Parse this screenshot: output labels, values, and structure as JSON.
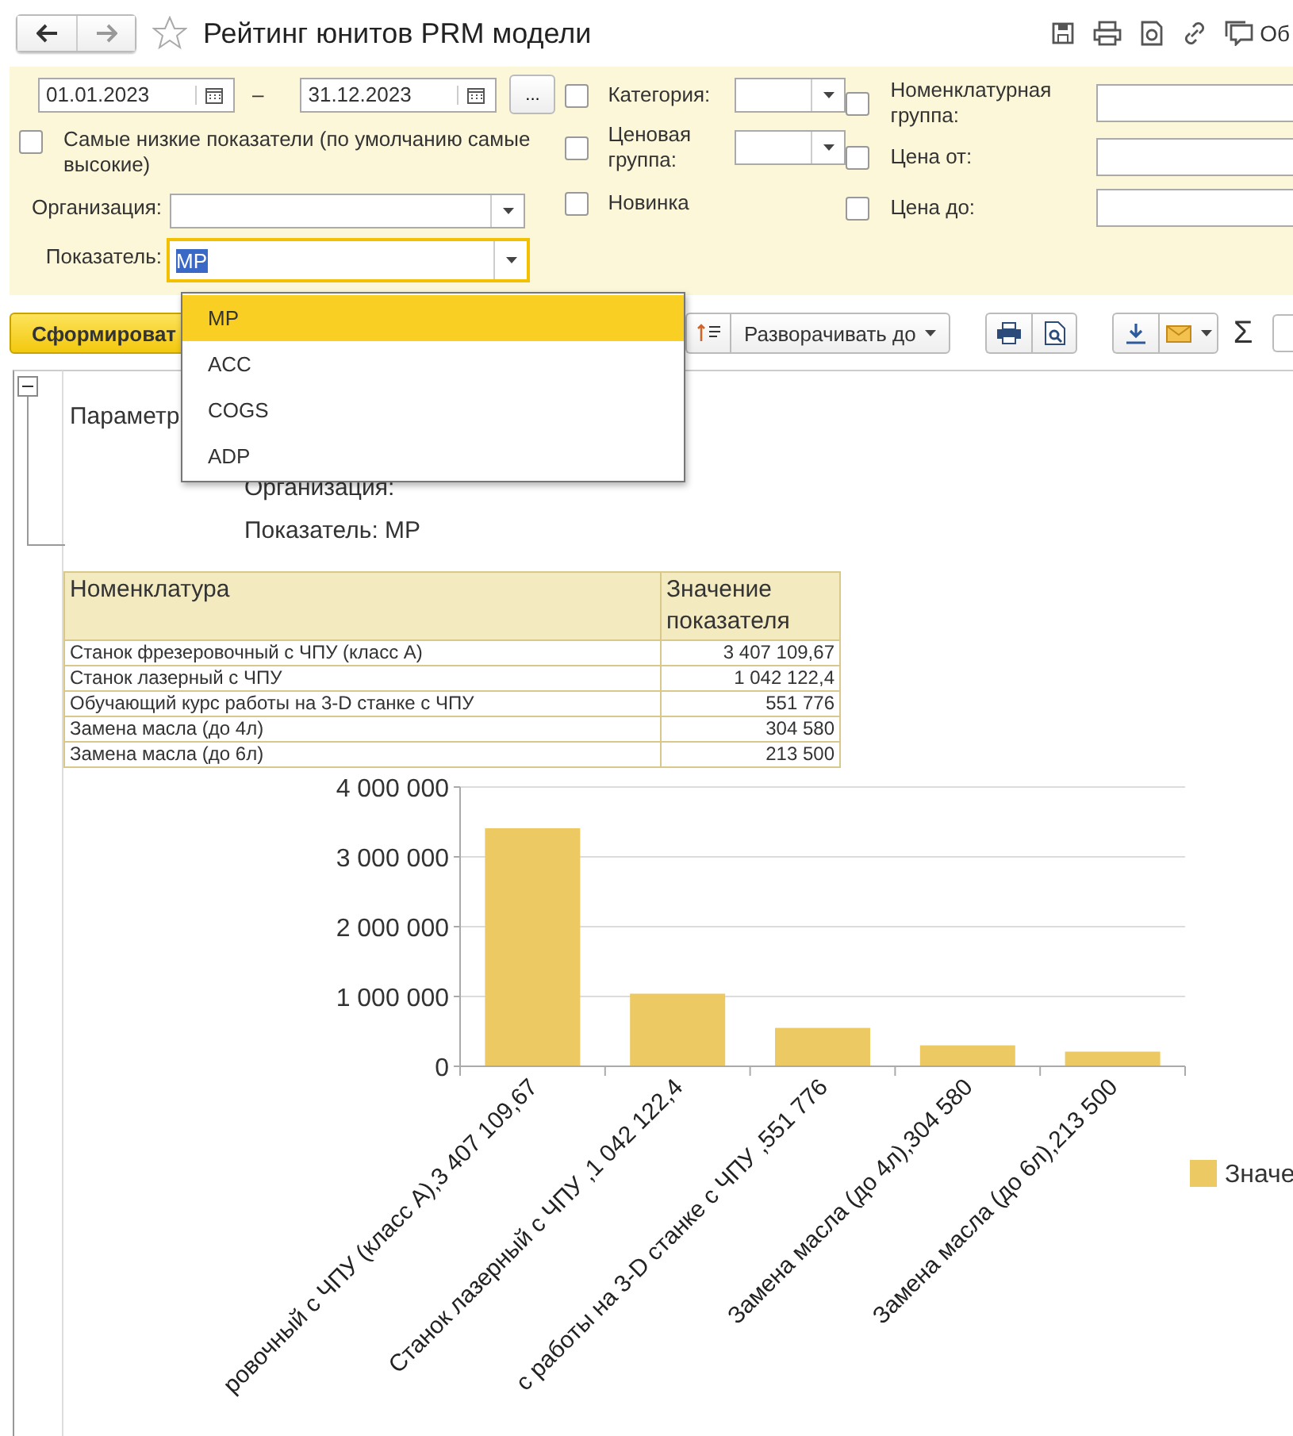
{
  "window": {
    "title": "Рейтинг юнитов PRM модели",
    "favorite": false,
    "header_action": "Об"
  },
  "filters": {
    "date_from": "01.01.2023",
    "date_separator": "–",
    "date_to": "31.12.2023",
    "period_button": "...",
    "lowest": {
      "label": "Самые низкие показатели (по умолчанию самые высокие)",
      "checked": false
    },
    "organization": {
      "label": "Организация:"
    },
    "indicator": {
      "label": "Показатель:",
      "value": "MP",
      "focused": true
    },
    "middle": [
      {
        "label": "Категория:",
        "checked": false,
        "kind": "select"
      },
      {
        "label": "Ценовая группа:",
        "checked": false,
        "kind": "select"
      },
      {
        "label": "Новинка",
        "checked": false,
        "kind": "plain"
      }
    ],
    "right": [
      {
        "label": "Номенклатурная группа:",
        "checked": false,
        "kind": "input"
      },
      {
        "label": "Цена от:",
        "checked": false,
        "kind": "input"
      },
      {
        "label": "Цена до:",
        "checked": false,
        "kind": "input"
      }
    ]
  },
  "dropdown": {
    "options": [
      {
        "label": "MP",
        "selected": true
      },
      {
        "label": "ACC",
        "selected": false
      },
      {
        "label": "COGS",
        "selected": false
      },
      {
        "label": "ADP",
        "selected": false
      }
    ]
  },
  "toolbar": {
    "generate_button": "Сформироват",
    "expand_button": "Разворачивать до",
    "sum_button": "Σ"
  },
  "report": {
    "params_title": "Параметр",
    "params": [
      "Организация:",
      "Показатель: MP"
    ],
    "table": {
      "columns": [
        "Номенклатура",
        "Значение показателя"
      ],
      "rows": [
        [
          "Станок фрезеровочный с ЧПУ (класс А)",
          "3 407 109,67"
        ],
        [
          "Станок лазерный с ЧПУ",
          "1 042 122,4"
        ],
        [
          "Обучающий курс работы на 3-D станке с ЧПУ",
          "551 776"
        ],
        [
          "Замена масла (до 4л)",
          "304 580"
        ],
        [
          "Замена масла (до 6л)",
          "213 500"
        ]
      ]
    },
    "chart_data": {
      "type": "bar",
      "categories": [
        "ровочный с ЧПУ (класс А),3 407 109,67",
        "Станок лазерный с ЧПУ ,1 042 122,4",
        "с работы на 3-D станке с ЧПУ ,551 776",
        "Замена масла (до 4л),304 580",
        "Замена масла (до 6л),213 500"
      ],
      "series": [
        {
          "name": "Значе",
          "color": "#ecc962",
          "values": [
            3410000,
            1040000,
            550000,
            300000,
            210000
          ]
        }
      ],
      "grid": true,
      "ylim": [
        0,
        4000000
      ],
      "yticks": [
        {
          "value": 0,
          "label": "0"
        },
        {
          "value": 1000000,
          "label": "1 000 000"
        },
        {
          "value": 2000000,
          "label": "2 000 000"
        },
        {
          "value": 3000000,
          "label": "3 000 000"
        },
        {
          "value": 4000000,
          "label": "4 000 000"
        }
      ]
    }
  }
}
